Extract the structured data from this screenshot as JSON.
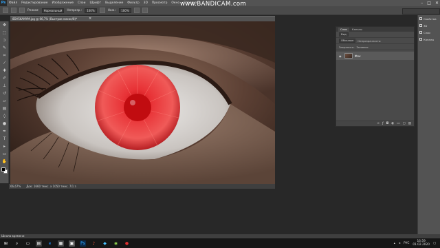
{
  "app": {
    "logo": "Ps",
    "menu": [
      "Файл",
      "Редактирование",
      "Изображение",
      "Слои",
      "Шрифт",
      "Выделение",
      "Фильтр",
      "3D",
      "Просмотр",
      "Окно",
      "Справка"
    ],
    "watermark": "www.BANDICAM.com"
  },
  "options": {
    "size_label": "",
    "mode_label": "Режим:",
    "mode_value": "Нормальный",
    "opacity_label": "Непрозр.:",
    "opacity_value": "100%",
    "pressure_label": "Наж.:",
    "pressure_value": "100%",
    "flow_label": "",
    "flow_value": ""
  },
  "document": {
    "tab_label": "8DVSKAMYM.jpg @ 66,7% (Выстрак масок/8)*",
    "zoom": "66,67%",
    "doc_info": "Док: 1660 тмнс. x 1050 тмнс. 7/1 з",
    "eye_colors": {
      "iris": "#e0242a",
      "pupil": "#c40f14",
      "sclera": "#d9d6d4",
      "skin": "#5a4236"
    }
  },
  "layers_panel": {
    "tabs": [
      "Слои",
      "Каналы"
    ],
    "kind_label": "Вид",
    "blend_value": "Обычные",
    "opacity_label": "Непрозрачность:",
    "lock_label": "Закрепить:",
    "fill_label": "Заливка:",
    "layer_name": "Фон"
  },
  "right_dock": {
    "items": [
      {
        "icon": "properties-icon",
        "label": "Свойства"
      },
      {
        "icon": "3d-icon",
        "label": "3D"
      },
      {
        "icon": "layers-icon",
        "label": "Слои"
      },
      {
        "icon": "channels-icon",
        "label": "Каналы"
      }
    ]
  },
  "timeline_label": "Шкала времени",
  "taskbar": {
    "lang": "РУС",
    "time": "16:59",
    "date": "01.02.2020"
  }
}
